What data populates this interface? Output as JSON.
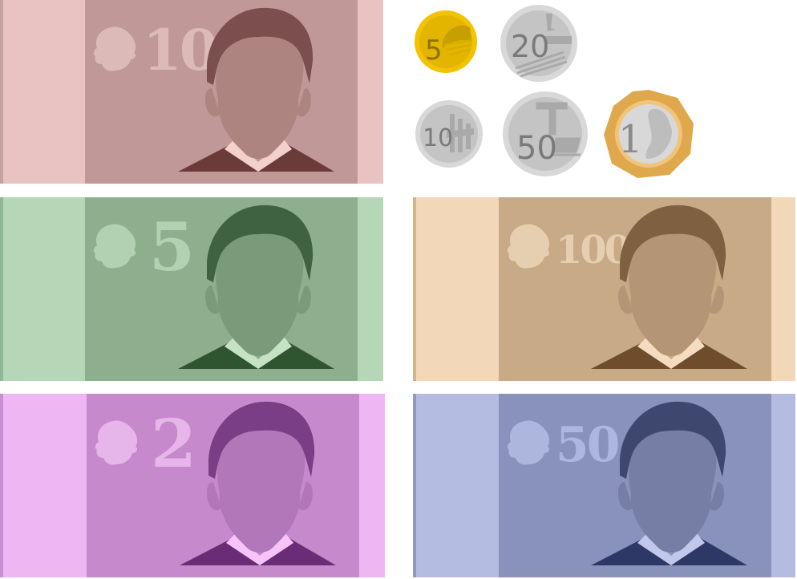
{
  "banknotes": [
    {
      "id": "10",
      "denomination": "10",
      "colors": {
        "light": "#e8c3c1",
        "main": "#c09898",
        "hair": "#7b4f4e",
        "face": "#ad8480",
        "suit": "#6b3b3a",
        "shirt": "#f4d0cc",
        "mark": "#dcbab8",
        "edge": "#c4a2a0"
      }
    },
    {
      "id": "5",
      "denomination": "5",
      "colors": {
        "light": "#b6d6b8",
        "main": "#8eaf8e",
        "hair": "#3f6340",
        "face": "#7a9b7a",
        "suit": "#2f5530",
        "shirt": "#c6e2c4",
        "mark": "#b2d0b2",
        "edge": "#8fb894"
      }
    },
    {
      "id": "100",
      "denomination": "100",
      "colors": {
        "light": "#f2d8b8",
        "main": "#c8ab86",
        "hair": "#7f6040",
        "face": "#b49676",
        "suit": "#6f4c2c",
        "shirt": "#f5dcc0",
        "mark": "#e6ceb0",
        "edge": "#d2b48f"
      }
    },
    {
      "id": "2",
      "denomination": "2",
      "colors": {
        "light": "#eeb6f2",
        "main": "#c689cc",
        "hair": "#7a3e86",
        "face": "#b277b8",
        "suit": "#6a2c76",
        "shirt": "#f7c4fa",
        "mark": "#e6b6ea",
        "edge": "#c98ed0"
      }
    },
    {
      "id": "50",
      "denomination": "50",
      "colors": {
        "light": "#b4bce2",
        "main": "#8992ba",
        "hair": "#3e486e",
        "face": "#767ea6",
        "suit": "#2e3866",
        "shirt": "#c2c8ec",
        "mark": "#adb6dc",
        "edge": "#8f98c4"
      }
    }
  ],
  "coins": [
    {
      "id": "5c",
      "value": "5",
      "colors": {
        "rim": "#f2c300",
        "face": "#e3b400",
        "text": "#8a7200",
        "art": "#c89f00"
      }
    },
    {
      "id": "20c",
      "value": "20",
      "colors": {
        "rim": "#d8d8d8",
        "face": "#c4c4c4",
        "text": "#7a7a7a",
        "art": "#a9a9a9"
      }
    },
    {
      "id": "10c",
      "value": "10",
      "colors": {
        "rim": "#d8d8d8",
        "face": "#c4c4c4",
        "text": "#7a7a7a",
        "art": "#a9a9a9"
      }
    },
    {
      "id": "50c",
      "value": "50",
      "colors": {
        "rim": "#d8d8d8",
        "face": "#c4c4c4",
        "text": "#7a7a7a",
        "art": "#a9a9a9"
      }
    },
    {
      "id": "1d",
      "value": "1",
      "colors": {
        "rim": "#e0a84c",
        "face": "#d8d8d8",
        "text": "#8a8a8a",
        "art": "#bdbdbd"
      }
    }
  ],
  "icons": {
    "watermark": "lion-head-icon",
    "portrait": "portrait-silhouette-icon"
  }
}
